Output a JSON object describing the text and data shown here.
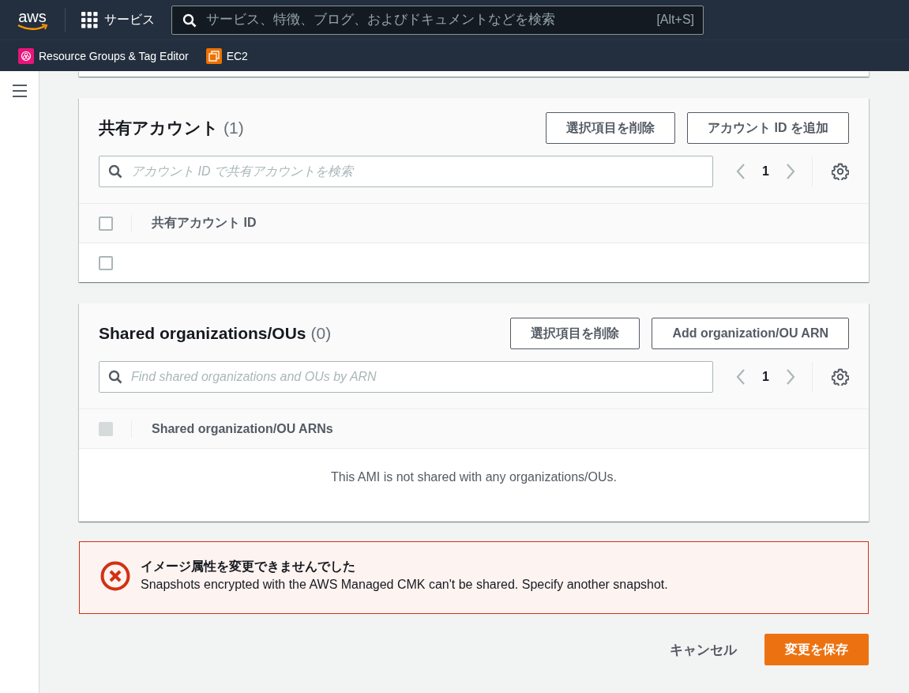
{
  "nav": {
    "logo": "aws",
    "services": "サービス",
    "search": {
      "placeholder": "サービス、特徴、ブログ、およびドキュメントなどを検索",
      "shortcut": "[Alt+S]"
    }
  },
  "favorites": [
    {
      "label": "Resource Groups & Tag Editor",
      "kind": "resource-groups"
    },
    {
      "label": "EC2",
      "kind": "ec2"
    }
  ],
  "panels": [
    {
      "title": "共有アカウント",
      "count": "(1)",
      "buttons": [
        "選択項目を削除",
        "アカウント ID を追加"
      ],
      "search": {
        "placeholder": "アカウント ID で共有アカウントを検索"
      },
      "page": "1",
      "columns": [
        "共有アカウント ID"
      ],
      "header_checkbox": {
        "checked": false,
        "disabled": false
      },
      "rows": [
        {
          "checked": false,
          "disabled": false
        }
      ]
    },
    {
      "title": "Shared organizations/OUs",
      "count": "(0)",
      "buttons": [
        "選択項目を削除",
        "Add organization/OU ARN"
      ],
      "search": {
        "placeholder": "Find shared organizations and OUs by ARN"
      },
      "page": "1",
      "columns": [
        "Shared organization/OU ARNs"
      ],
      "header_checkbox": {
        "checked": false,
        "disabled": true
      },
      "empty_message": "This AMI is not shared with any organizations/OUs."
    }
  ],
  "alert": {
    "kind": "error",
    "title": "イメージ属性を変更できませんでした",
    "message": "Snapshots encrypted with the AWS Managed CMK can't be shared. Specify another snapshot."
  },
  "footer": {
    "cancel": "キャンセル",
    "save": "変更を保存"
  }
}
